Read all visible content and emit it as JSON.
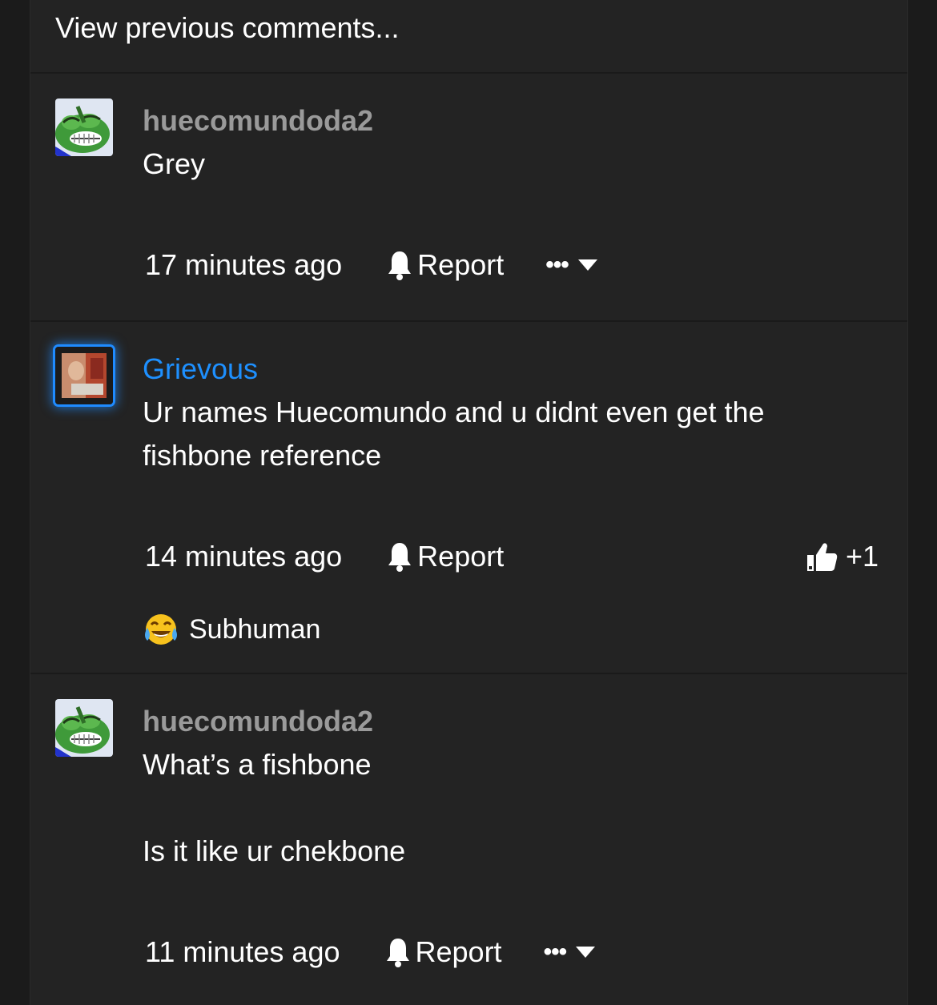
{
  "thread": {
    "view_previous_label": "View previous comments..."
  },
  "comments": [
    {
      "username": "huecomundoda2",
      "body_lines": [
        "Grey"
      ],
      "timestamp": "17 minutes ago",
      "report_label": "Report",
      "more_label": "•••"
    },
    {
      "username": "Grievous",
      "body_lines": [
        "Ur names Huecomundo and u didnt even get the",
        "fishbone reference"
      ],
      "timestamp": "14 minutes ago",
      "report_label": "Report",
      "like_count": "+1",
      "reaction": {
        "icon": "crying-laughing-emoji-icon",
        "label": "Subhuman"
      }
    },
    {
      "username": "huecomundoda2",
      "body_lines": [
        "What’s a fishbone",
        "",
        "Is it like ur chekbone"
      ],
      "timestamp": "11 minutes ago",
      "report_label": "Report",
      "more_label": "•••"
    }
  ],
  "colors": {
    "background": "#232323",
    "username_default": "#9a9a9a",
    "username_highlight": "#1e90ff",
    "avatar_glow": "#1f8bff"
  }
}
